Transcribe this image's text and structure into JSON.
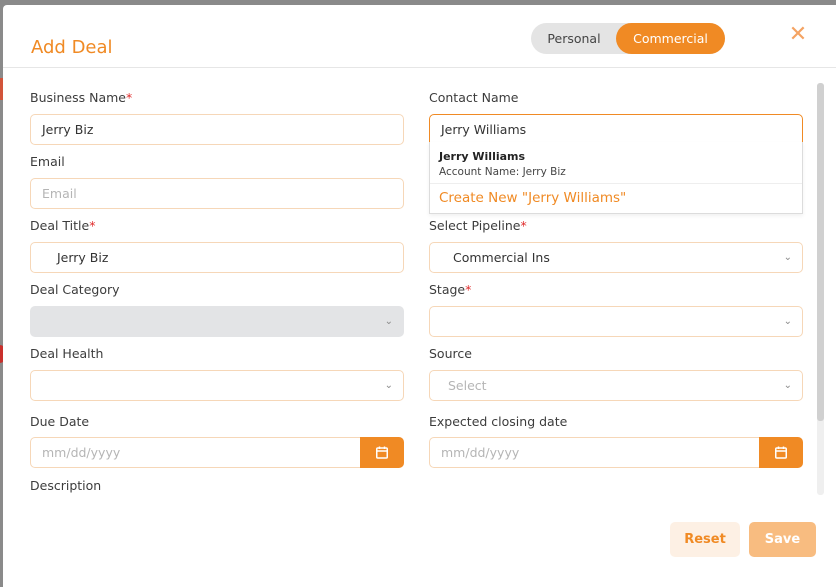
{
  "modal": {
    "title": "Add Deal",
    "close_symbol": "✕",
    "toggle": {
      "personal": "Personal",
      "commercial": "Commercial",
      "selected": "Commercial"
    }
  },
  "form": {
    "business_name": {
      "label": "Business Name",
      "value": "Jerry Biz",
      "required": true
    },
    "contact_name": {
      "label": "Contact Name",
      "value": "Jerry Williams"
    },
    "email": {
      "label": "Email",
      "placeholder": "Email"
    },
    "deal_title": {
      "label": "Deal Title",
      "value": "Jerry Biz",
      "required": true
    },
    "select_pipeline": {
      "label": "Select Pipeline",
      "value": "Commercial Ins",
      "required": true
    },
    "deal_category": {
      "label": "Deal Category",
      "value": ""
    },
    "stage": {
      "label": "Stage",
      "value": "",
      "required": true
    },
    "deal_health": {
      "label": "Deal Health",
      "value": ""
    },
    "source": {
      "label": "Source",
      "placeholder": "Select"
    },
    "due_date": {
      "label": "Due Date",
      "placeholder": "mm/dd/yyyy"
    },
    "expected_closing_date": {
      "label": "Expected closing date",
      "placeholder": "mm/dd/yyyy"
    },
    "description": {
      "label": "Description"
    }
  },
  "contact_dropdown": {
    "suggestion_name": "Jerry Williams",
    "suggestion_account": "Account Name: Jerry Biz",
    "create_new": "Create New \"Jerry Williams\""
  },
  "actions": {
    "reset": "Reset",
    "save": "Save"
  },
  "required_marker": "*",
  "chevron_symbol": "⌄",
  "icons": [
    "close-icon",
    "chevron-down-icon",
    "calendar-icon"
  ],
  "colors": {
    "accent": "#f08a24",
    "field_border": "#f6d7b8",
    "required": "#e02b2b",
    "disabled_bg": "#e3e4e6"
  }
}
